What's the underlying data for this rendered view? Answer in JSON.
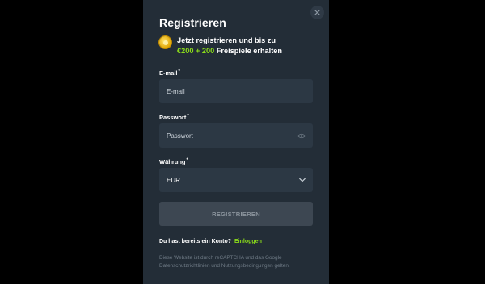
{
  "modal": {
    "title": "Registrieren",
    "close_icon": "close-icon"
  },
  "promo": {
    "icon": "coin-icon",
    "line1": "Jetzt registrieren und bis zu",
    "highlight": "€200 + 200",
    "line2_rest": "Freispiele erhalten",
    "highlight_color": "#8bdc1a"
  },
  "email": {
    "label": "E-mail",
    "required_mark": "*",
    "placeholder": "E-mail"
  },
  "password": {
    "label": "Passwort",
    "required_mark": "*",
    "placeholder": "Passwort",
    "toggle_icon": "eye-icon"
  },
  "currency": {
    "label": "Währung",
    "required_mark": "*",
    "value": "EUR",
    "chevron_icon": "chevron-down-icon"
  },
  "submit": {
    "label": "REGISTRIEREN"
  },
  "account": {
    "question": "Du hast bereits ein Konto?",
    "login_link": "Einloggen"
  },
  "recaptcha": {
    "text": "Diese Website ist durch reCAPTCHA und das Google Datenschutzrichtlinien und Nutzungsbedingungen gelten."
  }
}
